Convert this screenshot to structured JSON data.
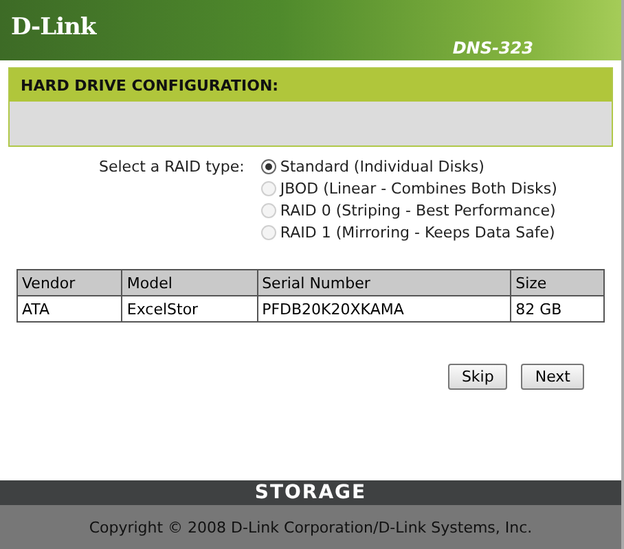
{
  "header": {
    "logo": "D-Link",
    "model": "DNS-323"
  },
  "section": {
    "title": "HARD DRIVE CONFIGURATION:"
  },
  "raid": {
    "label": "Select a RAID type:",
    "options": [
      {
        "label": "Standard (Individual Disks)",
        "selected": true,
        "disabled": false
      },
      {
        "label": "JBOD (Linear - Combines Both Disks)",
        "selected": false,
        "disabled": true
      },
      {
        "label": "RAID 0 (Striping - Best Performance)",
        "selected": false,
        "disabled": true
      },
      {
        "label": "RAID 1 (Mirroring - Keeps Data Safe)",
        "selected": false,
        "disabled": true
      }
    ]
  },
  "table": {
    "columns": [
      "Vendor",
      "Model",
      "Serial Number",
      "Size"
    ],
    "rows": [
      [
        "ATA",
        "ExcelStor",
        "PFDB20K20XKAMA",
        "82 GB"
      ]
    ]
  },
  "buttons": [
    "Skip",
    "Next"
  ],
  "footer_bar": "STORAGE",
  "copyright": "Copyright © 2008 D-Link Corporation/D-Link Systems, Inc."
}
